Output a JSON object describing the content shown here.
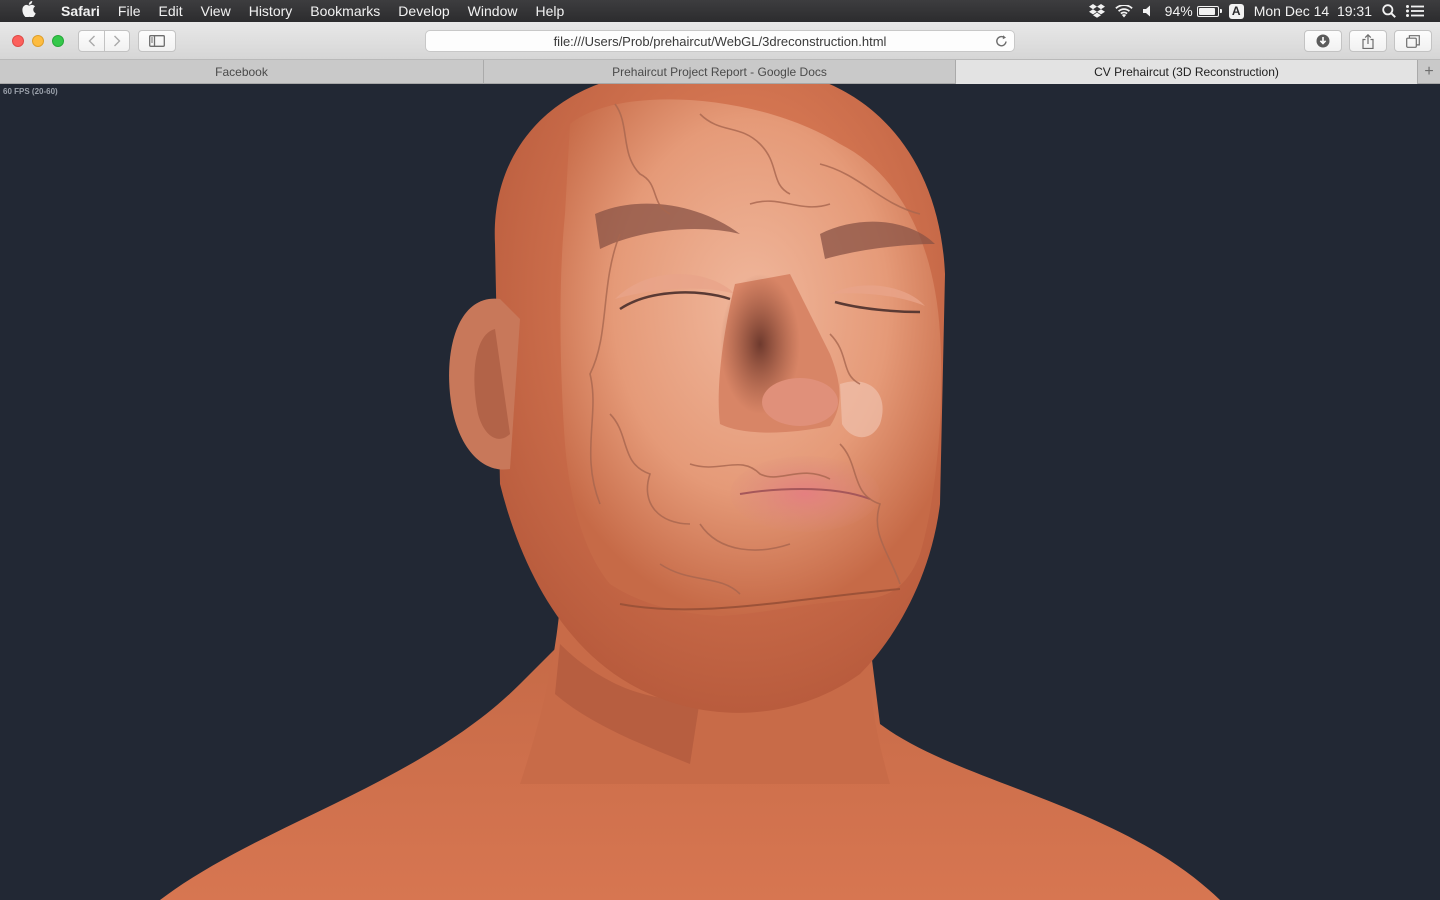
{
  "menubar": {
    "app_name": "Safari",
    "items": [
      "File",
      "Edit",
      "View",
      "History",
      "Bookmarks",
      "Develop",
      "Window",
      "Help"
    ],
    "battery_percent": "94%",
    "battery_level": 0.94,
    "input_source": "A",
    "datetime": "Mon Dec 14  19:31"
  },
  "toolbar": {
    "url": "file:///Users/Prob/prehaircut/WebGL/3dreconstruction.html"
  },
  "tabs": [
    {
      "label": "Facebook",
      "active": false
    },
    {
      "label": "Prehaircut Project Report - Google Docs",
      "active": false
    },
    {
      "label": "CV Prehaircut (3D Reconstruction)",
      "active": true
    }
  ],
  "viewport": {
    "fps_label": "60 FPS (20-60)",
    "background_color": "#222834",
    "skin_color": "#d8744c"
  }
}
